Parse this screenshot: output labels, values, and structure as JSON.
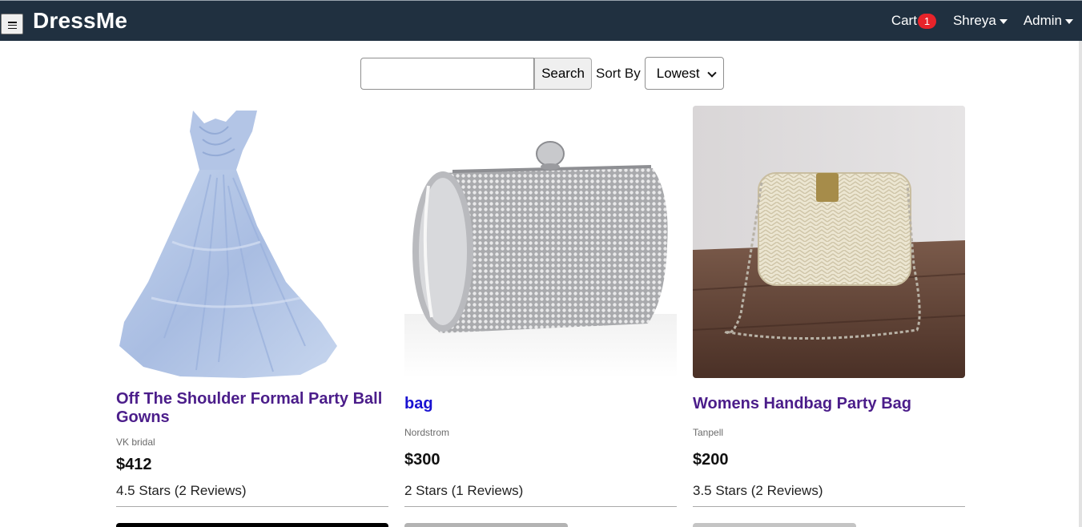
{
  "app": {
    "name": "DressMe"
  },
  "nav": {
    "cart_label": "Cart",
    "cart_count": "1",
    "user_label": "Shreya",
    "admin_label": "Admin"
  },
  "search": {
    "value": "",
    "placeholder": "",
    "button_label": "Search",
    "sort_label": "Sort By",
    "sort_selected": "Lowest"
  },
  "products": [
    {
      "name": "Off The Shoulder Formal Party Ball Gowns",
      "brand": "VK bridal",
      "price": "$412",
      "rating": "4.5 Stars (2 Reviews)",
      "image": "ball-gown-image"
    },
    {
      "name": "bag",
      "brand": "Nordstrom",
      "price": "$300",
      "rating": "2 Stars (1 Reviews)",
      "image": "crystal-clutch-image"
    },
    {
      "name": "Womens Handbag Party Bag",
      "brand": "Tanpell",
      "price": "$200",
      "rating": "3.5 Stars (2 Reviews)",
      "image": "woven-handbag-image"
    }
  ],
  "colors": {
    "navbar": "#203040",
    "title_visited": "#4b1d8a",
    "title_link": "#1a12d1",
    "badge": "#e8232a"
  }
}
